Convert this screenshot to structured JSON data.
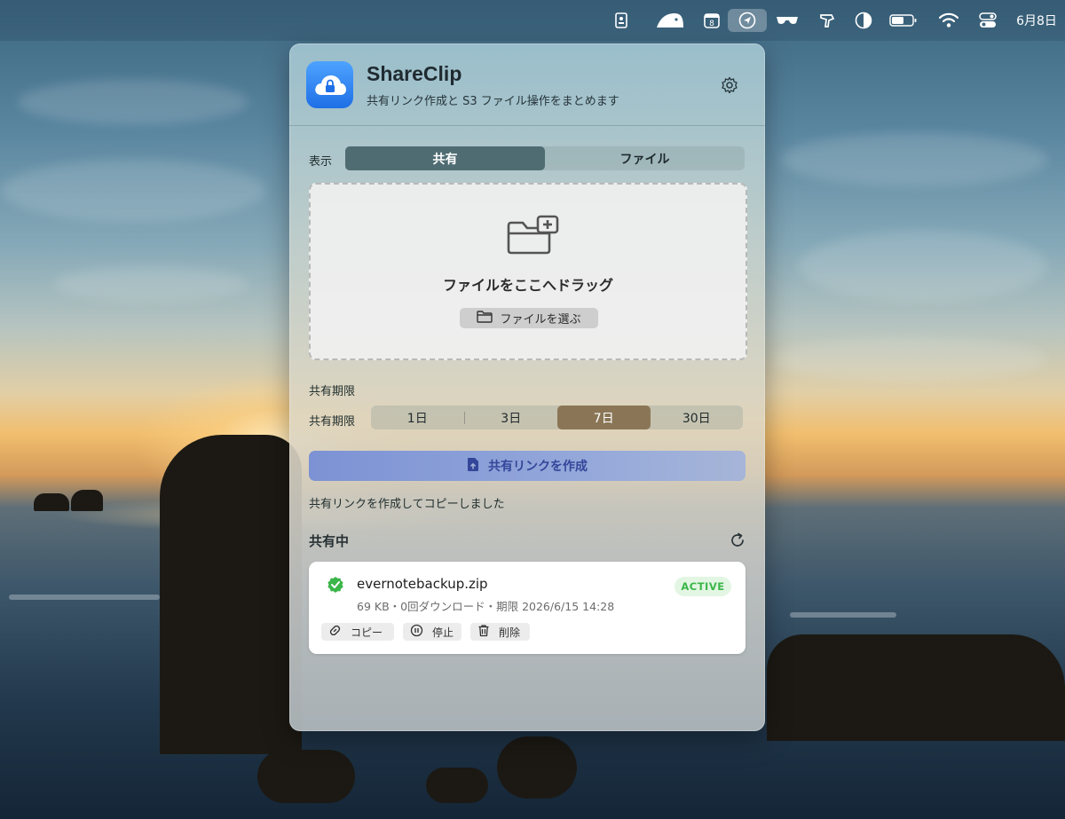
{
  "menubar": {
    "date": "6月8日",
    "calendar_day": "8"
  },
  "app": {
    "title": "ShareClip",
    "subtitle": "共有リンク作成と S3 ファイル操作をまとめます"
  },
  "view": {
    "label": "表示",
    "tabs": [
      {
        "label": "共有",
        "selected": true
      },
      {
        "label": "ファイル",
        "selected": false
      }
    ]
  },
  "dropzone": {
    "title": "ファイルをここへドラッグ",
    "choose_label": "ファイルを選ぶ"
  },
  "expiry": {
    "section_label": "共有期限",
    "row_label": "共有期限",
    "options": [
      {
        "label": "1日",
        "selected": false
      },
      {
        "label": "3日",
        "selected": false
      },
      {
        "label": "7日",
        "selected": true
      },
      {
        "label": "30日",
        "selected": false
      }
    ]
  },
  "create_button": "共有リンクを作成",
  "status_message": "共有リンクを作成してコピーしました",
  "sharing": {
    "title": "共有中",
    "items": [
      {
        "file_name": "evernotebackup.zip",
        "meta": "69 KB・0回ダウンロード・期限 2026/6/15 14:28",
        "status": "ACTIVE",
        "actions": {
          "copy": "コピー",
          "stop": "停止",
          "delete": "削除"
        }
      }
    ]
  },
  "colors": {
    "accent_blue": "#1f6fe6",
    "active_green": "#3cb64a",
    "selected_tab": "#4f6c72",
    "selected_expiry": "#8a7656"
  }
}
